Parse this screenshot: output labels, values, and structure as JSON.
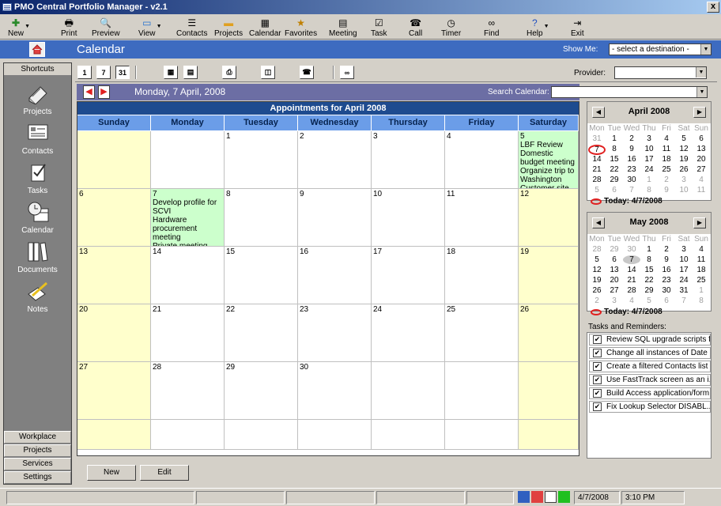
{
  "window": {
    "title": "PMO Central Portfolio Manager - v2.1",
    "close": "x"
  },
  "toolbar": {
    "new": "New",
    "print": "Print",
    "preview": "Preview",
    "view": "View",
    "contacts": "Contacts",
    "projects": "Projects",
    "calendar": "Calendar",
    "favorites": "Favorites",
    "meeting": "Meeting",
    "task": "Task",
    "call": "Call",
    "timer": "Timer",
    "find": "Find",
    "help": "Help",
    "exit": "Exit"
  },
  "header": {
    "title": "Calendar",
    "show_me_label": "Show Me:",
    "destination": "- select a destination -"
  },
  "sidebar": {
    "shortcuts": "Shortcuts",
    "items": [
      "Projects",
      "Contacts",
      "Tasks",
      "Calendar",
      "Documents",
      "Notes"
    ],
    "bottom": [
      "Workplace",
      "Projects",
      "Services",
      "Settings"
    ]
  },
  "viewbar": {
    "day": "1",
    "week": "7",
    "month": "31",
    "provider_label": "Provider:"
  },
  "datebar": {
    "date": "Monday, 7 April, 2008",
    "search_label": "Search Calendar:"
  },
  "grid": {
    "title": "Appointments for April 2008",
    "days": [
      "Sunday",
      "Monday",
      "Tuesday",
      "Wednesday",
      "Thursday",
      "Friday",
      "Saturday"
    ],
    "weeks": [
      [
        {
          "d": "",
          "e": []
        },
        {
          "d": "",
          "e": []
        },
        {
          "d": "1",
          "e": []
        },
        {
          "d": "2",
          "e": []
        },
        {
          "d": "3",
          "e": []
        },
        {
          "d": "4",
          "e": []
        },
        {
          "d": "5",
          "e": [
            "LBF Review",
            "Domestic budget meeting",
            "Organize trip to Washington",
            "Customer site visit"
          ]
        }
      ],
      [
        {
          "d": "6",
          "e": []
        },
        {
          "d": "7",
          "e": [
            "Develop profile for SCVI",
            "Hardware procurement meeting",
            "Private meeting"
          ]
        },
        {
          "d": "8",
          "e": []
        },
        {
          "d": "9",
          "e": []
        },
        {
          "d": "10",
          "e": []
        },
        {
          "d": "11",
          "e": []
        },
        {
          "d": "12",
          "e": []
        }
      ],
      [
        {
          "d": "13",
          "e": []
        },
        {
          "d": "14",
          "e": []
        },
        {
          "d": "15",
          "e": []
        },
        {
          "d": "16",
          "e": []
        },
        {
          "d": "17",
          "e": []
        },
        {
          "d": "18",
          "e": []
        },
        {
          "d": "19",
          "e": []
        }
      ],
      [
        {
          "d": "20",
          "e": []
        },
        {
          "d": "21",
          "e": []
        },
        {
          "d": "22",
          "e": []
        },
        {
          "d": "23",
          "e": []
        },
        {
          "d": "24",
          "e": []
        },
        {
          "d": "25",
          "e": []
        },
        {
          "d": "26",
          "e": []
        }
      ],
      [
        {
          "d": "27",
          "e": []
        },
        {
          "d": "28",
          "e": []
        },
        {
          "d": "29",
          "e": []
        },
        {
          "d": "30",
          "e": []
        },
        {
          "d": "",
          "e": []
        },
        {
          "d": "",
          "e": []
        },
        {
          "d": "",
          "e": []
        }
      ],
      [
        {
          "d": "",
          "e": []
        },
        {
          "d": "",
          "e": []
        },
        {
          "d": "",
          "e": []
        },
        {
          "d": "",
          "e": []
        },
        {
          "d": "",
          "e": []
        },
        {
          "d": "",
          "e": []
        },
        {
          "d": "",
          "e": []
        }
      ]
    ]
  },
  "mini_april": {
    "title": "April 2008",
    "weekdays": [
      "Mon",
      "Tue",
      "Wed",
      "Thu",
      "Fri",
      "Sat",
      "Sun"
    ],
    "rows": [
      [
        "31",
        "1",
        "2",
        "3",
        "4",
        "5",
        "6"
      ],
      [
        "7",
        "8",
        "9",
        "10",
        "11",
        "12",
        "13"
      ],
      [
        "14",
        "15",
        "16",
        "17",
        "18",
        "19",
        "20"
      ],
      [
        "21",
        "22",
        "23",
        "24",
        "25",
        "26",
        "27"
      ],
      [
        "28",
        "29",
        "30",
        "1",
        "2",
        "3",
        "4"
      ],
      [
        "5",
        "6",
        "7",
        "8",
        "9",
        "10",
        "11"
      ]
    ],
    "today": "Today: 4/7/2008"
  },
  "mini_may": {
    "title": "May 2008",
    "weekdays": [
      "Mon",
      "Tue",
      "Wed",
      "Thu",
      "Fri",
      "Sat",
      "Sun"
    ],
    "rows": [
      [
        "28",
        "29",
        "30",
        "1",
        "2",
        "3",
        "4"
      ],
      [
        "5",
        "6",
        "7",
        "8",
        "9",
        "10",
        "11"
      ],
      [
        "12",
        "13",
        "14",
        "15",
        "16",
        "17",
        "18"
      ],
      [
        "19",
        "20",
        "21",
        "22",
        "23",
        "24",
        "25"
      ],
      [
        "26",
        "27",
        "28",
        "29",
        "30",
        "31",
        "1"
      ],
      [
        "2",
        "3",
        "4",
        "5",
        "6",
        "7",
        "8"
      ]
    ],
    "today": "Today: 4/7/2008"
  },
  "tasks": {
    "label": "Tasks and Reminders:",
    "items": [
      "Review SQL upgrade scripts f...",
      "Change all instances of Date ...",
      "Create a filtered Contacts list",
      "Use FastTrack screen as an i...",
      "Build Access application/form...",
      "Fix Lookup Selector DISABL..."
    ]
  },
  "buttons": {
    "new": "New",
    "edit": "Edit"
  },
  "status": {
    "date": "4/7/2008",
    "time": "3:10 PM"
  }
}
